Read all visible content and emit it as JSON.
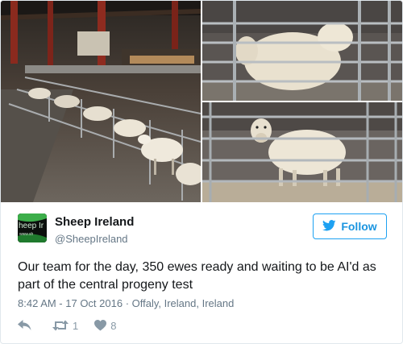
{
  "author": {
    "display_name": "Sheep Ireland",
    "screen_name": "@SheepIreland",
    "avatar_text_1": "heep Ir",
    "avatar_text_2": "www.sh"
  },
  "follow_label": "Follow",
  "tweet": {
    "text": "Our team for the day, 350 ewes ready and waiting to be AI'd as part of the central progeny test",
    "timestamp": "8:42 AM - 17 Oct 2016",
    "separator": " · ",
    "location": "Offaly, Ireland, Ireland"
  },
  "stats": {
    "retweets": "1",
    "likes": "8"
  },
  "colors": {
    "accent": "#1da1f2",
    "follow_text": "#1b95e0",
    "muted": "#657786",
    "action": "#8899a6",
    "avatar_green": "#3cae4a"
  },
  "icons": {
    "reply": "reply-icon",
    "retweet": "retweet-icon",
    "like": "heart-icon",
    "follow": "twitter-bird-icon"
  }
}
